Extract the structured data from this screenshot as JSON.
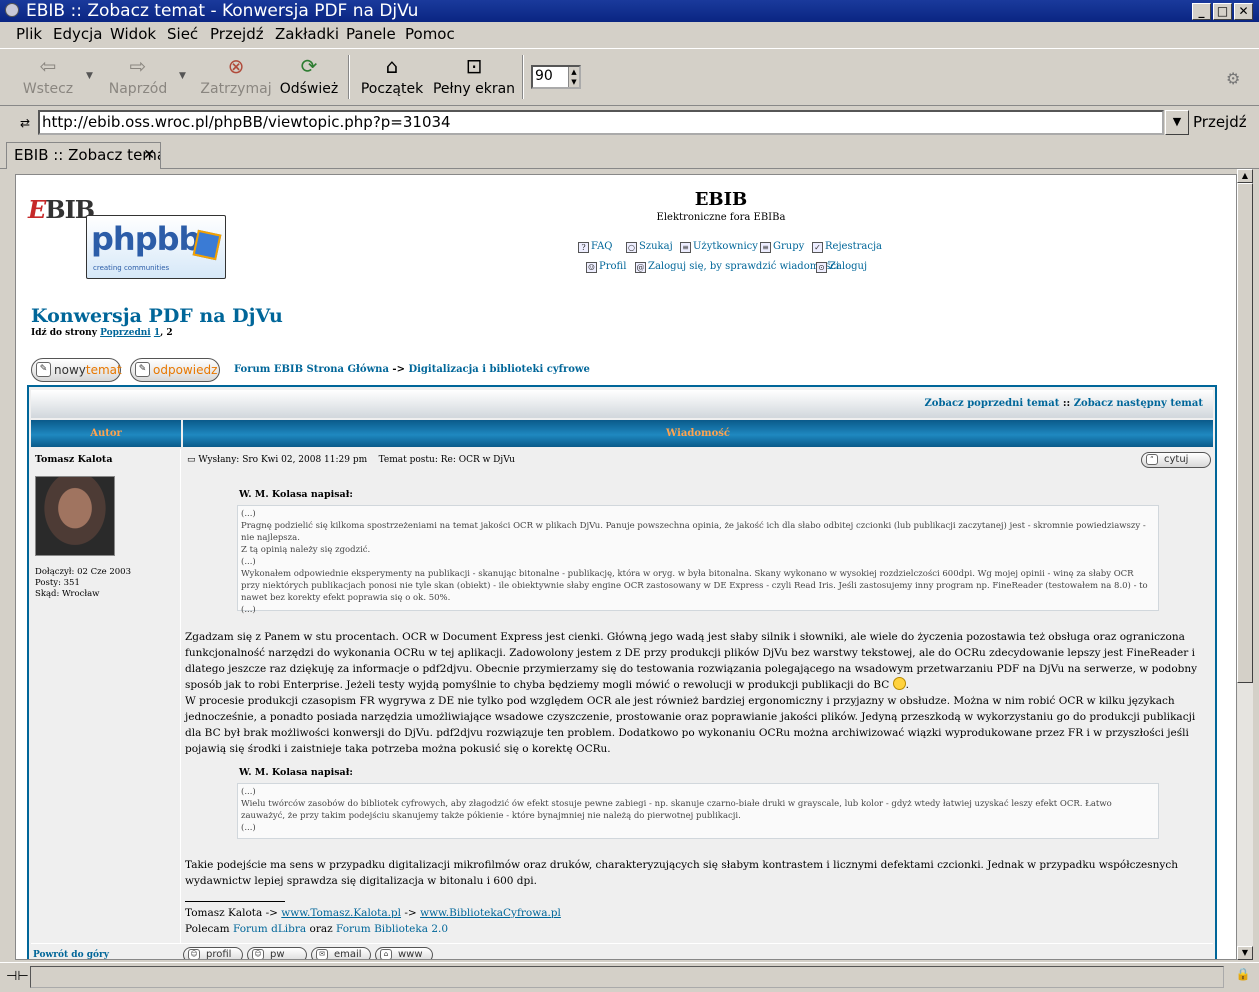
{
  "window": {
    "title": "EBIB :: Zobacz temat - Konwersja PDF na DjVu",
    "minimize": "_",
    "maximize": "□",
    "close": "✕"
  },
  "menu": [
    "Plik",
    "Edycja",
    "Widok",
    "Sieć",
    "Przejdź",
    "Zakładki",
    "Panele",
    "Pomoc"
  ],
  "toolbar": {
    "back": "Wstecz",
    "forward": "Naprzód",
    "stop": "Zatrzymaj",
    "reload": "Odśwież",
    "home": "Początek",
    "fullscreen": "Pełny ekran",
    "zoom": "90"
  },
  "location": {
    "url": "http://ebib.oss.wroc.pl/phpBB/viewtopic.php?p=31034",
    "go": "Przejdź"
  },
  "tabs": [
    {
      "label": "EBIB :: Zobacz temat - Konwersja PDF na DjVu"
    }
  ],
  "site": {
    "logo_text": "EBIB",
    "phpbb_logo": "phpbb",
    "phpbb_tagline": "creating communities",
    "title": "EBIB",
    "description": "Elektroniczne fora EBIBa",
    "nav": {
      "faq": "FAQ",
      "search": "Szukaj",
      "members": "Użytkownicy",
      "groups": "Grupy",
      "register": "Rejestracja",
      "profile": "Profil",
      "pm": "Zaloguj się, by sprawdzić wiadomości",
      "login": "Zaloguj"
    }
  },
  "topic": {
    "title": "Konwersja PDF na DjVu",
    "pages_prefix": "Idź do strony",
    "prev": "Poprzedni",
    "page1": "1",
    "page_sep": ",",
    "page2": "2",
    "new_topic_a": "nowy",
    "new_topic_b": "temat",
    "reply": "odpowiedz",
    "crumb_home": "Forum EBIB Strona Główna",
    "crumb_sep": "->",
    "crumb_forum": "Digitalizacja i biblioteki cyfrowe",
    "prev_topic": "Zobacz poprzedni temat",
    "topic_sep": "::",
    "next_topic": "Zobacz następny temat",
    "col_author": "Autor",
    "col_message": "Wiadomość"
  },
  "post": {
    "author": "Tomasz Kalota",
    "joined": "Dołączył: 02 Cze 2003",
    "posts": "Posty: 351",
    "from": "Skąd: Wrocław",
    "posted": "Wysłany: Sro Kwi 02, 2008 11:29 pm",
    "subject": "Temat postu: Re: OCR w DjVu",
    "quote_button": "cytuj",
    "quote1_header": "W. M. Kolasa napisał:",
    "quote1_lines": [
      "(...)",
      "Pragnę podzielić się kilkoma spostrzeżeniami na temat jakości OCR w plikach DjVu. Panuje powszechna opinia, że jakość ich dla słabo odbitej czcionki (lub publikacji zaczytanej) jest - skromnie powiedziawszy - nie najlepsza.",
      "Z tą opinią należy się zgodzić.",
      "(...)",
      "Wykonałem odpowiednie eksperymenty na publikacji - skanując bitonalne - publikację, która w oryg. w była bitonalna. Skany wykonano w wysokiej rozdzielczości 600dpi. Wg mojej opinii - winę za słaby OCR przy niektórych publikacjach ponosi nie tyle skan (obiekt) - ile obiektywnie słaby engine OCR zastosowany w DE Express - czyli Read Iris. Jeśli zastosujemy inny program np. FineReader (testowałem na 8.0) - to nawet bez korekty efekt poprawia się o ok. 50%.",
      "(...)"
    ],
    "body1": [
      "Zgadzam się z Panem w stu procentach. OCR w Document Express jest cienki. Główną jego wadą jest słaby silnik i słowniki, ale wiele do życzenia pozostawia też obsługa oraz ograniczona funkcjonalność narzędzi do wykonania OCRu w tej aplikacji. Zadowolony jestem z DE przy produkcji plików DjVu bez warstwy tekstowej, ale do OCRu zdecydowanie lepszy jest FineReader i dlatego jeszcze raz dziękuję za informacje o pdf2djvu. Obecnie przymierzamy się do testowania rozwiązania polegającego na wsadowym przetwarzaniu PDF na DjVu na serwerze, w podobny sposób jak to robi Enterprise. Jeżeli testy wyjdą pomyślnie to chyba będziemy mogli mówić o rewolucji w produkcji publikacji do BC",
      "W procesie produkcji czasopism FR wygrywa z DE nie tylko pod względem OCR ale jest również bardziej ergonomiczny i przyjazny w obsłudze. Można w nim robić OCR w kilku językach jednocześnie, a ponadto posiada narzędzia umożliwiające wsadowe czyszczenie, prostowanie oraz poprawianie jakości plików. Jedyną przeszkodą w wykorzystaniu go do produkcji publikacji dla BC był brak możliwości konwersji do DjVu. pdf2djvu rozwiązuje ten problem. Dodatkowo po wykonaniu OCRu można archiwizować wiązki wyprodukowane przez FR i w przyszłości jeśli pojawią się środki i zaistnieje taka potrzeba można pokusić się o korektę OCRu."
    ],
    "quote2_header": "W. M. Kolasa napisał:",
    "quote2_lines": [
      "(...)",
      "Wielu twórców zasobów do bibliotek cyfrowych, aby złagodzić ów efekt stosuje pewne zabiegi - np. skanuje czarno-białe druki w grayscale, lub kolor - gdyż wtedy łatwiej uzyskać leszy efekt OCR. Łatwo zauważyć, że przy takim podejściu skanujemy także pókienie - które bynajmniej nie należą do pierwotnej publikacji.",
      "(...)"
    ],
    "body2": "Takie podejście ma sens w przypadku digitalizacji mikrofilmów oraz druków, charakteryzujących się słabym kontrastem i licznymi defektami czcionki. Jednak w przypadku współczesnych wydawnictw lepiej sprawdza się digitalizacja w bitonalu i 600 dpi.",
    "sig_line1_name": "Tomasz Kalota",
    "sig_arrow": "->",
    "sig_link1": "www.Tomasz.Kalota.pl",
    "sig_link2": "www.BibliotekaCyfrowa.pl",
    "sig_line2_prefix": "Polecam",
    "sig_link3": "Forum dLibra",
    "sig_and": "oraz",
    "sig_link4": "Forum Biblioteka 2.0",
    "back_to_top": "Powrót do góry",
    "btn_profile": "profil",
    "btn_pm": "pw",
    "btn_email": "email",
    "btn_www": "www"
  },
  "icons": {
    "back": "arrow-left-icon",
    "forward": "arrow-right-icon",
    "stop": "stop-icon",
    "reload": "reload-icon",
    "home": "home-icon",
    "fullscreen": "fullscreen-icon"
  },
  "colors": {
    "titlebar": "#0a2582",
    "link": "#006699",
    "table_header_text": "#ffa34f",
    "forum_border": "#006699",
    "post_bg": "#efefef"
  }
}
